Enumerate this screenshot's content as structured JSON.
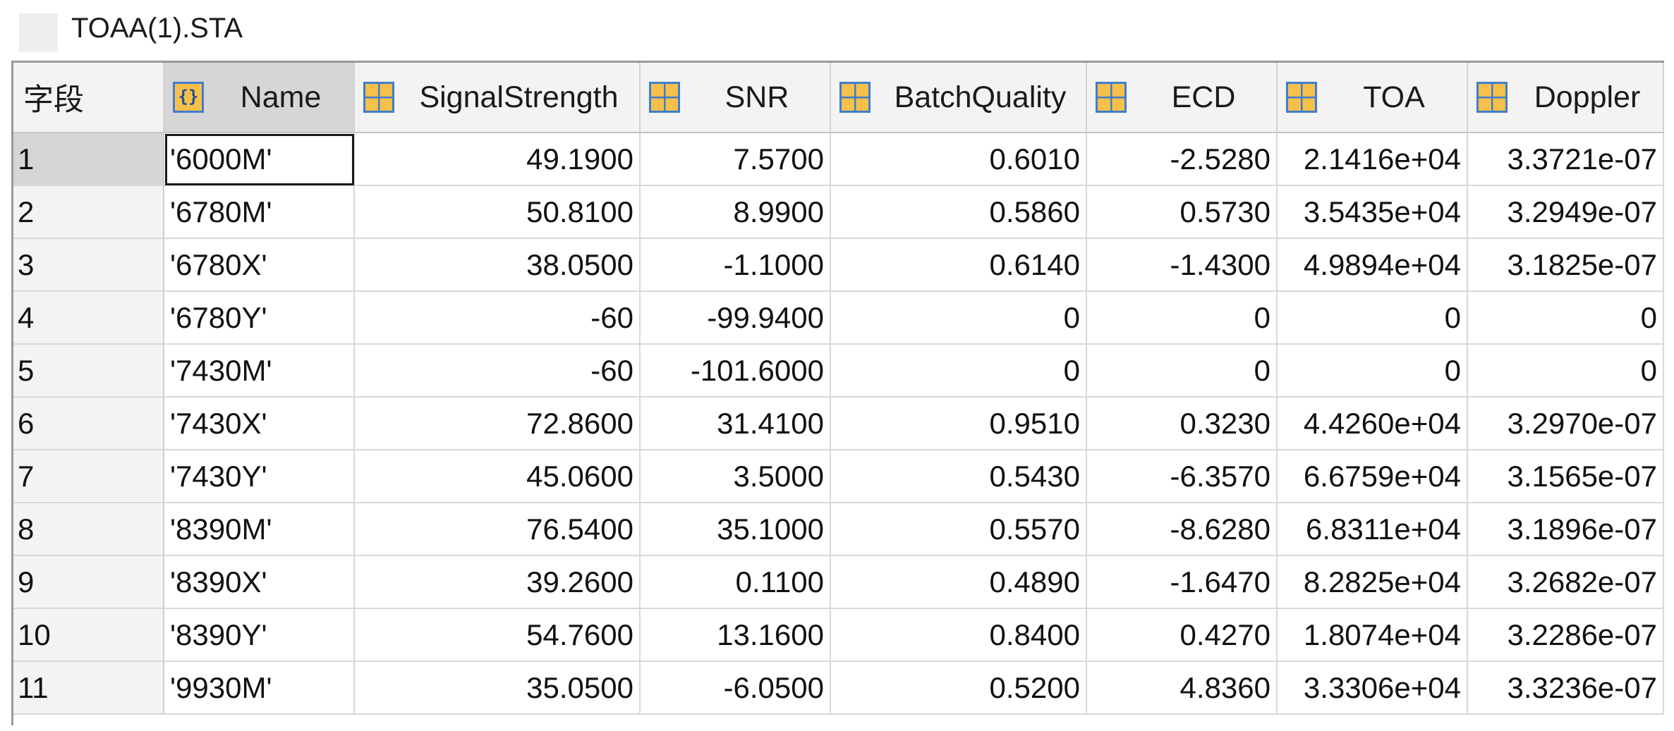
{
  "window": {
    "title": "TOAA(1).STA"
  },
  "table": {
    "corner_label": "字段",
    "columns": [
      {
        "label": "Name",
        "icon": "struct-array-icon"
      },
      {
        "label": "SignalStrength",
        "icon": "numeric-array-icon"
      },
      {
        "label": "SNR",
        "icon": "numeric-array-icon"
      },
      {
        "label": "BatchQuality",
        "icon": "numeric-array-icon"
      },
      {
        "label": "ECD",
        "icon": "numeric-array-icon"
      },
      {
        "label": "TOA",
        "icon": "numeric-array-icon"
      },
      {
        "label": "Doppler",
        "icon": "numeric-array-icon"
      }
    ],
    "rows": [
      {
        "index": "1",
        "cells": [
          "'6000M'",
          "49.1900",
          "7.5700",
          "0.6010",
          "-2.5280",
          "2.1416e+04",
          "3.3721e-07"
        ]
      },
      {
        "index": "2",
        "cells": [
          "'6780M'",
          "50.8100",
          "8.9900",
          "0.5860",
          "0.5730",
          "3.5435e+04",
          "3.2949e-07"
        ]
      },
      {
        "index": "3",
        "cells": [
          "'6780X'",
          "38.0500",
          "-1.1000",
          "0.6140",
          "-1.4300",
          "4.9894e+04",
          "3.1825e-07"
        ]
      },
      {
        "index": "4",
        "cells": [
          "'6780Y'",
          "-60",
          "-99.9400",
          "0",
          "0",
          "0",
          "0"
        ]
      },
      {
        "index": "5",
        "cells": [
          "'7430M'",
          "-60",
          "-101.6000",
          "0",
          "0",
          "0",
          "0"
        ]
      },
      {
        "index": "6",
        "cells": [
          "'7430X'",
          "72.8600",
          "31.4100",
          "0.9510",
          "0.3230",
          "4.4260e+04",
          "3.2970e-07"
        ]
      },
      {
        "index": "7",
        "cells": [
          "'7430Y'",
          "45.0600",
          "3.5000",
          "0.5430",
          "-6.3570",
          "6.6759e+04",
          "3.1565e-07"
        ]
      },
      {
        "index": "8",
        "cells": [
          "'8390M'",
          "76.5400",
          "35.1000",
          "0.5570",
          "-8.6280",
          "6.8311e+04",
          "3.1896e-07"
        ]
      },
      {
        "index": "9",
        "cells": [
          "'8390X'",
          "39.2600",
          "0.1100",
          "0.4890",
          "-1.6470",
          "8.2825e+04",
          "3.2682e-07"
        ]
      },
      {
        "index": "10",
        "cells": [
          "'8390Y'",
          "54.7600",
          "13.1600",
          "0.8400",
          "0.4270",
          "1.8074e+04",
          "3.2286e-07"
        ]
      },
      {
        "index": "11",
        "cells": [
          "'9930M'",
          "35.0500",
          "-6.0500",
          "0.5200",
          "4.8360",
          "3.3306e+04",
          "3.3236e-07"
        ]
      }
    ],
    "selected_column": 0,
    "selected_row": 0,
    "colors": {
      "header_bg": "#f3f3f3",
      "selected_bg": "#d6d6d6",
      "icon_fill": "#f7c04a",
      "icon_stroke": "#3e7dd0"
    }
  }
}
